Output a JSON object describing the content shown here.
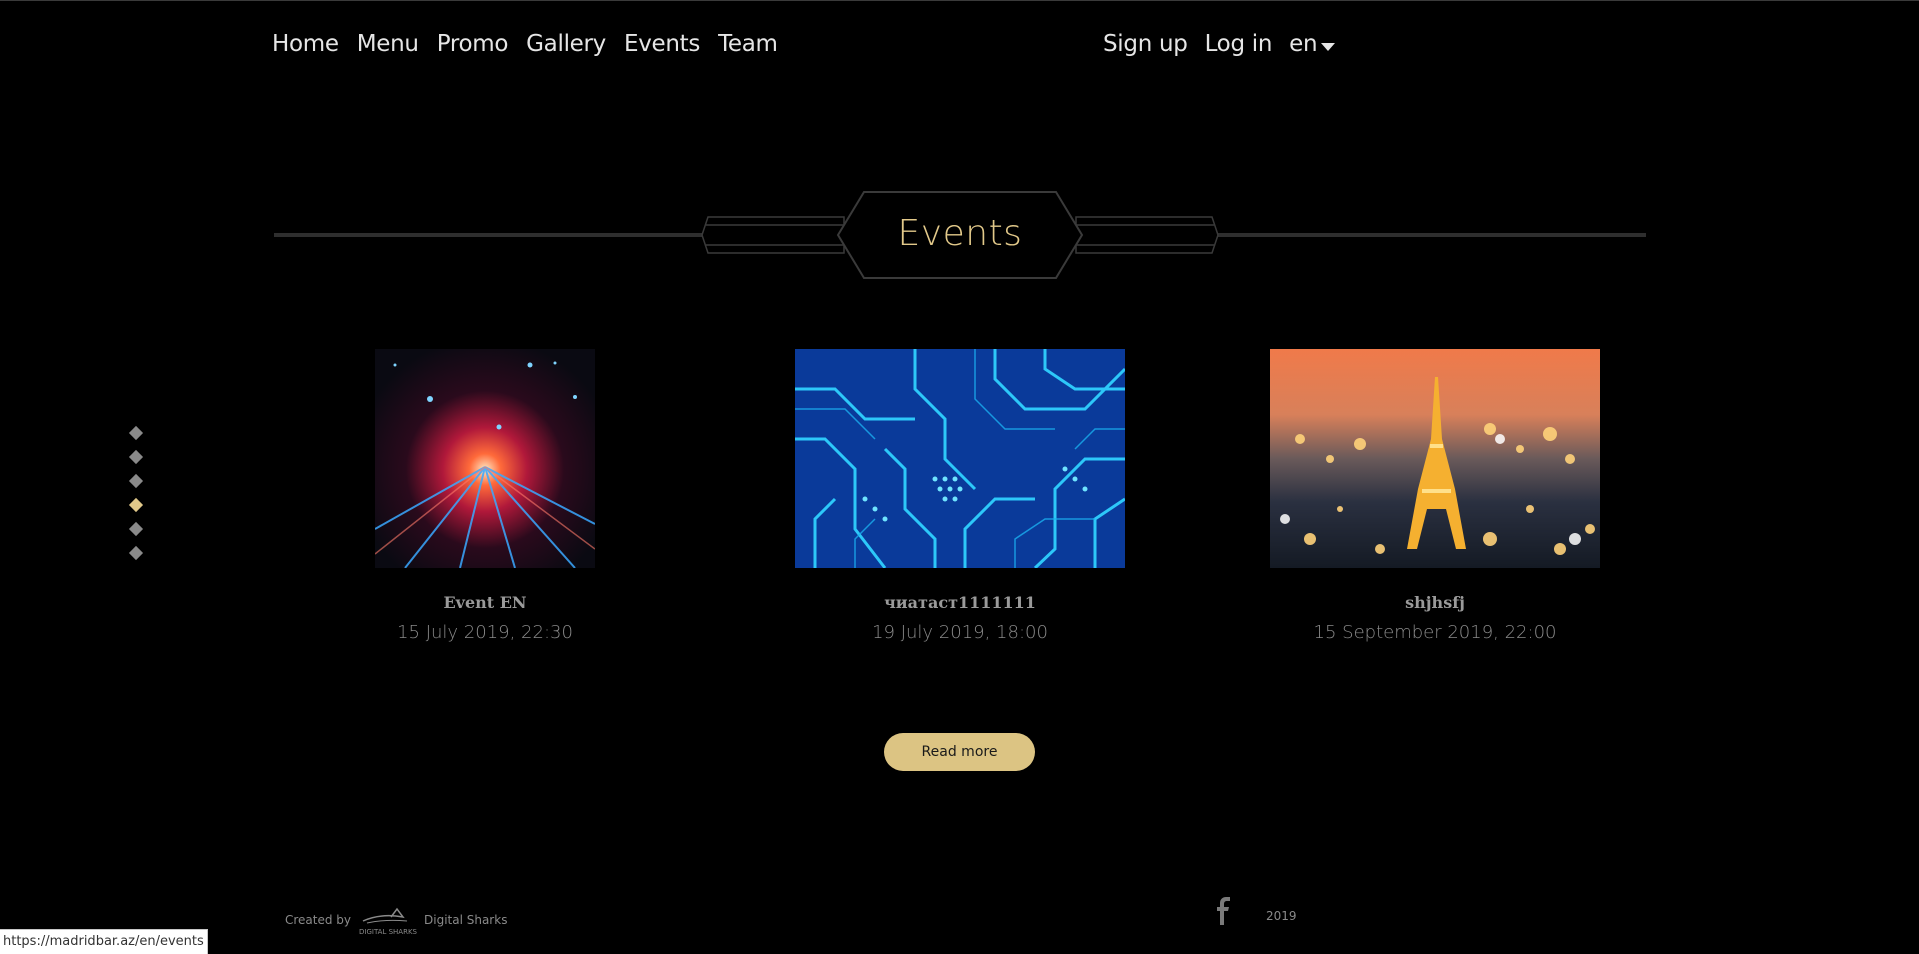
{
  "nav": {
    "left": [
      "Home",
      "Menu",
      "Promo",
      "Gallery",
      "Events",
      "Team"
    ],
    "right": {
      "signup": "Sign up",
      "login": "Log in",
      "language": "en"
    }
  },
  "section": {
    "title": "Events"
  },
  "pager": {
    "count": 6,
    "active_index": 3
  },
  "events": [
    {
      "name": "Event EN",
      "date": "15 July 2019, 22:30",
      "image": "light-speed-stars-image"
    },
    {
      "name": "чиатаст1111111",
      "date": "19 July 2019, 18:00",
      "image": "circuit-board-image"
    },
    {
      "name": "shjhsfj",
      "date": "15 September 2019, 22:00",
      "image": "eiffel-tower-image"
    }
  ],
  "read_more": "Read more",
  "footer": {
    "created_by": "Created by",
    "logo_text": "DIGITAL SHARKS",
    "company": "Digital Sharks",
    "year": "2019",
    "social": "facebook-icon"
  },
  "status_bar": {
    "url": "https://madridbar.az/en/events"
  },
  "colors": {
    "accent": "#e2c98a",
    "button": "#dcc483",
    "background": "#000000"
  }
}
